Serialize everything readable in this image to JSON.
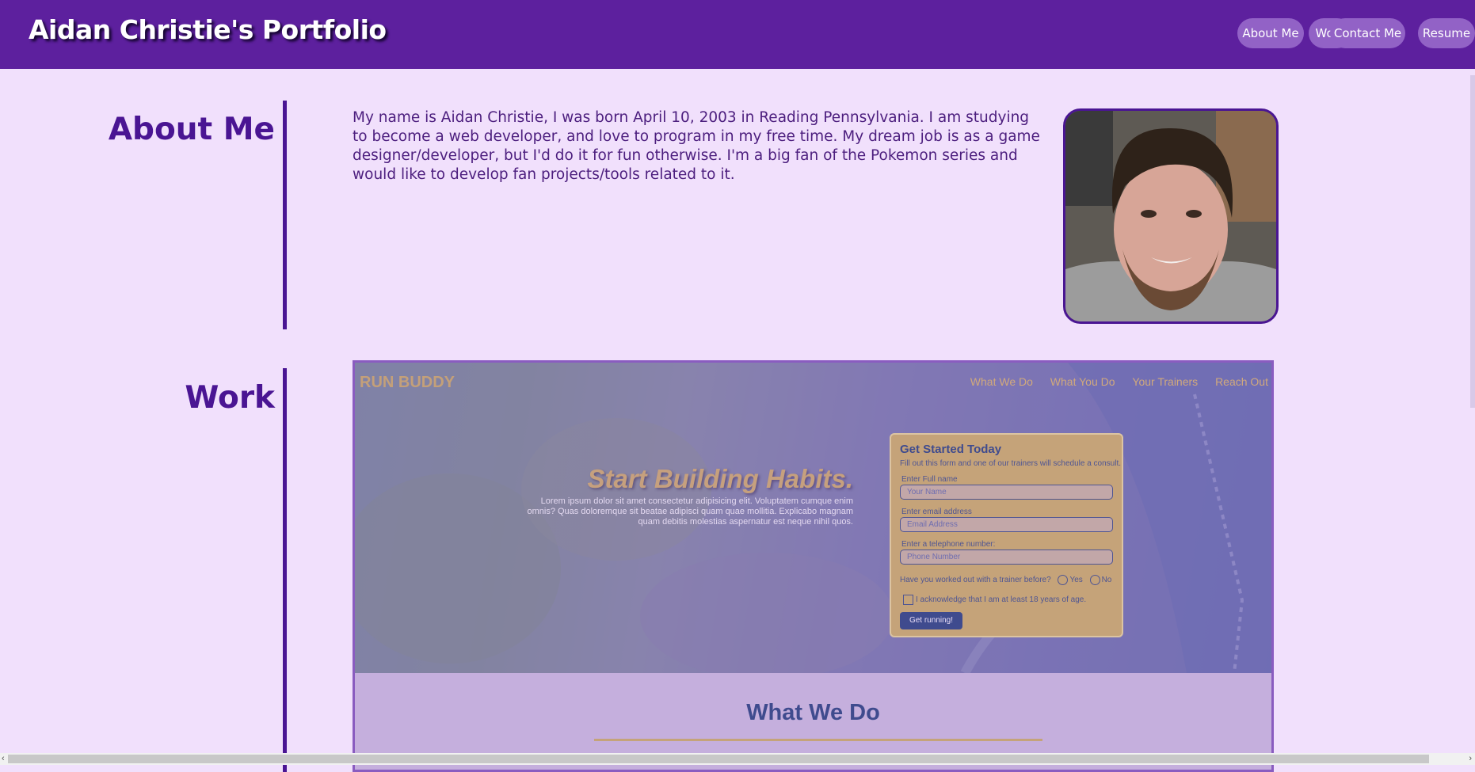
{
  "header": {
    "title": "Aidan Christie's Portfolio",
    "nav": [
      "About Me",
      "Work",
      "Contact Me",
      "Resume"
    ]
  },
  "about": {
    "heading": "About Me",
    "text": "My name is Aidan Christie, I was born April 10, 2003 in Reading Pennsylvania. I am studying to become a web developer, and love to program in my free time. My dream job is as a game designer/developer, but I'd do it for fun otherwise. I'm a big fan of the Pokemon series and would like to develop fan projects/tools related to it.",
    "photo_icon": "profile-photo"
  },
  "work": {
    "heading": "Work",
    "project": {
      "logo": "RUN BUDDY",
      "nav": [
        "What We Do",
        "What You Do",
        "Your Trainers",
        "Reach Out"
      ],
      "hero_title": "Start Building Habits.",
      "hero_text": "Lorem ipsum dolor sit amet consectetur adipisicing elit. Voluptatem cumque enim omnis? Quas doloremque sit beatae adipisci quam quae mollitia. Explicabo magnam quam debitis molestias aspernatur est neque nihil quos.",
      "form": {
        "title": "Get Started Today",
        "subtitle": "Fill out this form and one of our trainers will schedule a consult.",
        "name_label": "Enter Full name",
        "name_placeholder": "Your Name",
        "email_label": "Enter email address",
        "email_placeholder": "Email Address",
        "phone_label": "Enter a telephone number:",
        "phone_placeholder": "Phone Number",
        "question": "Have you worked out with a trainer before?",
        "yes": "Yes",
        "no": "No",
        "acknowledge": "I acknowledge that I am at least 18 years of age.",
        "submit": "Get running!"
      },
      "section_title": "What We Do"
    }
  },
  "colors": {
    "header_bg": "#5d209e",
    "page_bg": "#f1e0fc",
    "accent": "#4a1593",
    "nav_button": "#9262c6"
  }
}
